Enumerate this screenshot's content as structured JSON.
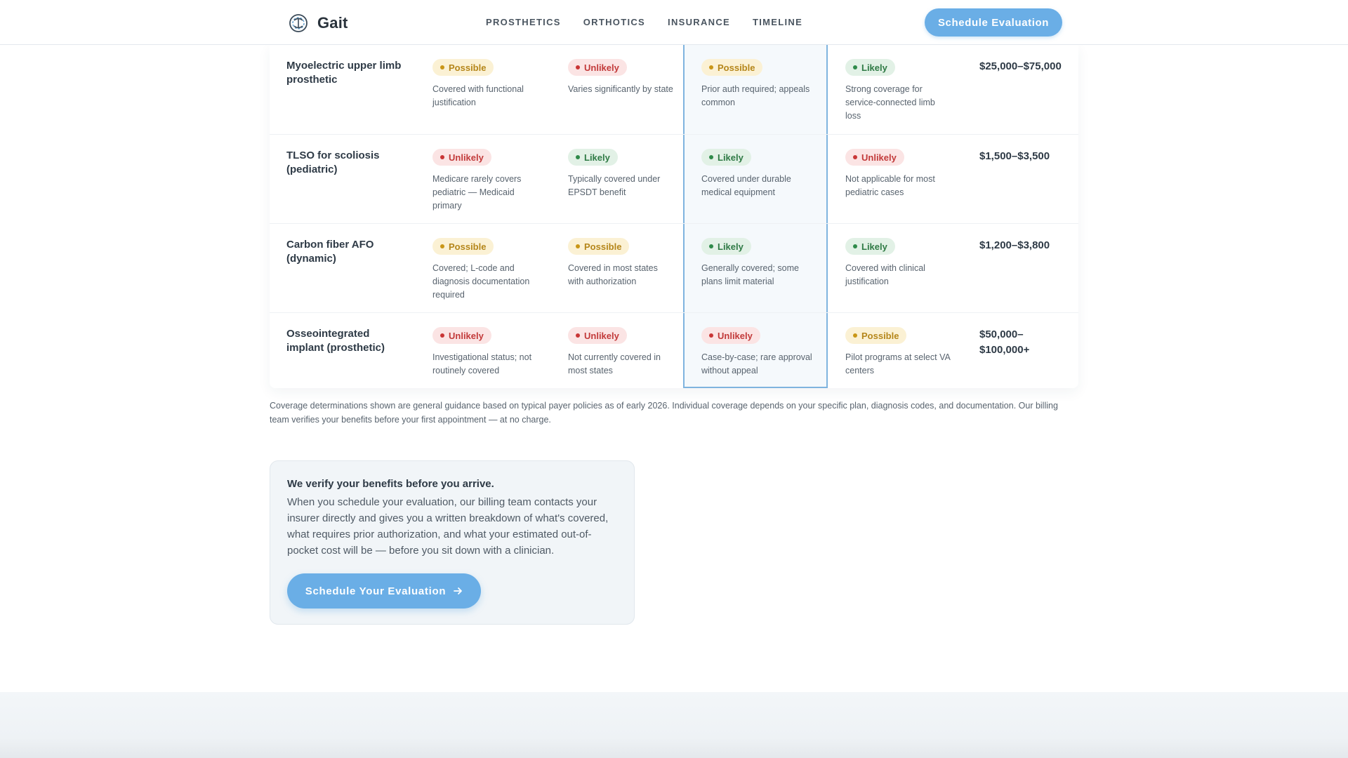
{
  "header": {
    "brand_name": "Gait",
    "nav": [
      "PROSTHETICS",
      "ORTHOTICS",
      "INSURANCE",
      "TIMELINE"
    ],
    "cta_label": "Schedule Evaluation"
  },
  "table": {
    "rows": [
      {
        "device": "Myoelectric upper limb prosthetic",
        "cells": [
          {
            "status": "Possible",
            "note": "Covered with functional justification"
          },
          {
            "status": "Unlikely",
            "note": "Varies significantly by state"
          },
          {
            "status": "Possible",
            "note": "Prior auth required; appeals common"
          },
          {
            "status": "Likely",
            "note": "Strong coverage for service-connected limb loss"
          }
        ],
        "cost": "$25,000–$75,000"
      },
      {
        "device": "TLSO for scoliosis (pediatric)",
        "cells": [
          {
            "status": "Unlikely",
            "note": "Medicare rarely covers pediatric — Medicaid primary"
          },
          {
            "status": "Likely",
            "note": "Typically covered under EPSDT benefit"
          },
          {
            "status": "Likely",
            "note": "Covered under durable medical equipment"
          },
          {
            "status": "Unlikely",
            "note": "Not applicable for most pediatric cases"
          }
        ],
        "cost": "$1,500–$3,500"
      },
      {
        "device": "Carbon fiber AFO (dynamic)",
        "cells": [
          {
            "status": "Possible",
            "note": "Covered; L-code and diagnosis documentation required"
          },
          {
            "status": "Possible",
            "note": "Covered in most states with authorization"
          },
          {
            "status": "Likely",
            "note": "Generally covered; some plans limit material"
          },
          {
            "status": "Likely",
            "note": "Covered with clinical justification"
          }
        ],
        "cost": "$1,200–$3,800"
      },
      {
        "device": "Osseointegrated implant (prosthetic)",
        "cells": [
          {
            "status": "Unlikely",
            "note": "Investigational status; not routinely covered"
          },
          {
            "status": "Unlikely",
            "note": "Not currently covered in most states"
          },
          {
            "status": "Unlikely",
            "note": "Case-by-case; rare approval without appeal"
          },
          {
            "status": "Possible",
            "note": "Pilot programs at select VA centers"
          }
        ],
        "cost": "$50,000–$100,000+"
      }
    ]
  },
  "disclaimer": "Coverage determinations shown are general guidance based on typical payer policies as of early 2026. Individual coverage depends on your specific plan, diagnosis codes, and documentation. Our billing team verifies your benefits before your first appointment — at no charge.",
  "info": {
    "title": "We verify your benefits before you arrive.",
    "body": "When you schedule your evaluation, our billing team contacts your insurer directly and gives you a written breakdown of what's covered, what requires prior authorization, and what your estimated out-of-pocket cost will be — before you sit down with a clinician.",
    "cta_label": "Schedule Your Evaluation"
  },
  "colors": {
    "accent": "#6aaee6",
    "possible": "#c99617",
    "unlikely": "#c93636",
    "likely": "#2f8a4a",
    "highlight_border": "#7fb4df"
  },
  "icons": {
    "brand": "gait-logo-icon",
    "cta": "arrow-right-icon",
    "status": "status-dot-icon"
  }
}
